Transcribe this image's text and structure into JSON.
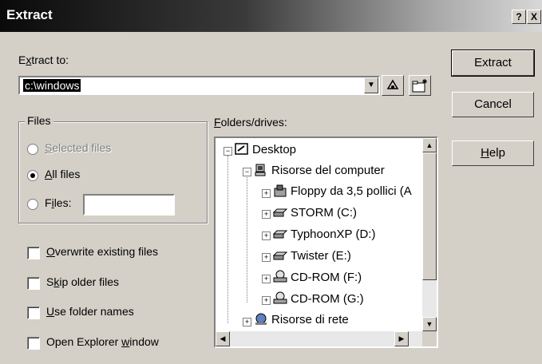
{
  "window": {
    "title": "Extract",
    "help_glyph": "?",
    "close_glyph": "X"
  },
  "extract_to": {
    "label_pre": "E",
    "label_u": "x",
    "label_post": "tract to:",
    "value": "c:\\windows"
  },
  "toolbar": {
    "browse_icon": "folder-browse-icon",
    "new_folder_icon": "new-folder-icon"
  },
  "buttons": {
    "extract": "Extract",
    "cancel": "Cancel",
    "help_u": "H",
    "help_rest": "elp"
  },
  "files_group": {
    "title": "Files",
    "selected": {
      "u": "S",
      "rest": "elected files"
    },
    "all": {
      "u": "A",
      "rest": "ll files"
    },
    "files": {
      "pre": "F",
      "u": "i",
      "rest": "les:"
    },
    "files_value": ""
  },
  "options": {
    "overwrite": {
      "u": "O",
      "rest": "verwrite existing files"
    },
    "skip": {
      "pre": "S",
      "u": "k",
      "rest": "ip older files"
    },
    "use_names": {
      "u": "U",
      "rest": "se folder names"
    },
    "open_explorer": {
      "pre": "Open Explorer ",
      "u": "w",
      "rest": "indow"
    }
  },
  "folders": {
    "label_u": "F",
    "label_rest": "olders/drives:",
    "tree": [
      {
        "label": "Desktop",
        "icon": "desktop-icon"
      },
      {
        "label": "Risorse del computer",
        "icon": "my-computer-icon"
      },
      {
        "label": "Floppy da 3,5 pollici (A",
        "icon": "floppy-icon"
      },
      {
        "label": "STORM (C:)",
        "icon": "hard-drive-icon"
      },
      {
        "label": "TyphoonXP (D:)",
        "icon": "hard-drive-icon"
      },
      {
        "label": "Twister (E:)",
        "icon": "hard-drive-icon"
      },
      {
        "label": "CD-ROM (F:)",
        "icon": "cdrom-icon"
      },
      {
        "label": "CD-ROM (G:)",
        "icon": "cdrom-icon"
      },
      {
        "label": "Risorse di rete",
        "icon": "network-icon"
      }
    ]
  }
}
